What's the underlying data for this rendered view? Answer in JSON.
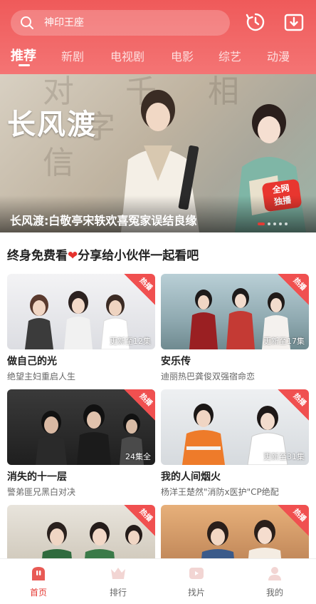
{
  "search": {
    "placeholder": "神印王座"
  },
  "tabs": [
    {
      "label": "推荐",
      "active": true
    },
    {
      "label": "新剧"
    },
    {
      "label": "电视剧"
    },
    {
      "label": "电影"
    },
    {
      "label": "综艺"
    },
    {
      "label": "动漫"
    }
  ],
  "banner": {
    "title_art": "长风渡",
    "badge_line1": "全网",
    "badge_line2": "独播",
    "caption": "长风渡:白敬亭宋轶欢喜冤家误结良缘",
    "dots_count": 5
  },
  "section": {
    "title_prefix": "终身免费看",
    "heart": "❤",
    "title_suffix": "分享给小伙伴一起看吧"
  },
  "cards": [
    {
      "title": "做自己的光",
      "subtitle": "绝望主妇重启人生",
      "hot": "热播",
      "episode": "更新至12集"
    },
    {
      "title": "安乐传",
      "subtitle": "迪丽热巴龚俊双强宿命恋",
      "hot": "热播",
      "episode": "更新至17集"
    },
    {
      "title": "消失的十一层",
      "subtitle": "警弟匪兄黑白对决",
      "hot": "热播",
      "episode": "24集全"
    },
    {
      "title": "我的人间烟火",
      "subtitle": "杨洋王楚然\"消防x医护\"CP绝配",
      "hot": "热播",
      "episode": "更新至31集"
    },
    {
      "title": "",
      "subtitle": "",
      "hot": "热播",
      "episode": ""
    },
    {
      "title": "",
      "subtitle": "",
      "hot": "热播",
      "episode": ""
    }
  ],
  "bottom_nav": [
    {
      "label": "首页",
      "icon": "home-icon",
      "active": true
    },
    {
      "label": "排行",
      "icon": "crown-icon"
    },
    {
      "label": "找片",
      "icon": "play-icon"
    },
    {
      "label": "我的",
      "icon": "user-icon"
    }
  ],
  "colors": {
    "accent": "#e53a34",
    "header": "#ef5a5a"
  }
}
